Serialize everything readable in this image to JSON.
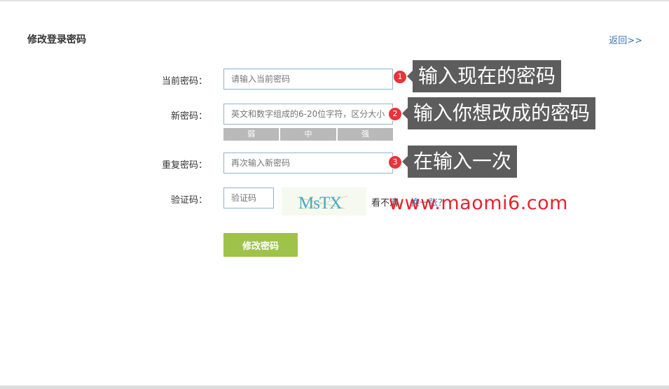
{
  "header": {
    "title": "修改登录密码",
    "back_link": "返回>>"
  },
  "form": {
    "current_password": {
      "label": "当前密码：",
      "placeholder": "请输入当前密码"
    },
    "new_password": {
      "label": "新密码：",
      "placeholder": "英文和数字组成的6-20位字符，区分大小"
    },
    "strength": {
      "weak": "弱",
      "medium": "中",
      "strong": "强"
    },
    "repeat_password": {
      "label": "重复密码：",
      "placeholder": "再次输入新密码"
    },
    "captcha": {
      "label": "验证码：",
      "placeholder": "验证码",
      "image_text": "MsTX",
      "unclear_text": "看不清，",
      "refresh_link": "换一张？"
    },
    "submit_label": "修改密码"
  },
  "annotations": [
    {
      "number": "1",
      "text": "输入现在的密码"
    },
    {
      "number": "2",
      "text": "输入你想改成的密码"
    },
    {
      "number": "3",
      "text": "在输入一次"
    }
  ],
  "watermark": "www.maomi6.com",
  "colors": {
    "link": "#3a73b5",
    "submit": "#9fc24b",
    "badge": "#e8343b",
    "callout": "#5d5d5d",
    "watermark": "#e6232f",
    "input_border": "#8fb4cc"
  }
}
